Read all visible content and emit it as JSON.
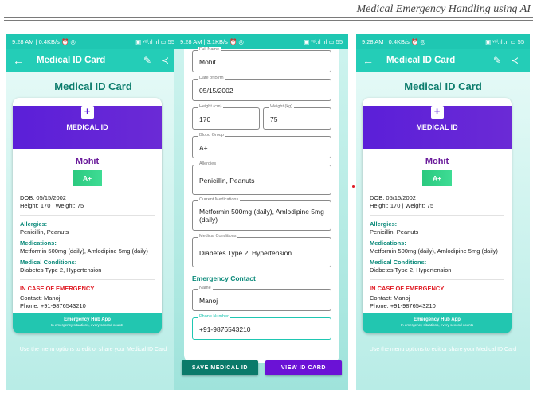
{
  "doc": {
    "title": "Medical Emergency Handling using AI"
  },
  "status": {
    "left1": "9:28 AM | 0.4KB/s ⏰ ◎",
    "left2": "9:28 AM | 3.1KB/s ⏰ ◎",
    "right": "▣ ᵛᵒˡ.ıl .ıl ▭ 55"
  },
  "appbar": {
    "title": "Medical ID Card",
    "back_icon": "arrow-left-icon",
    "edit_icon": "pencil-icon",
    "share_icon": "share-icon"
  },
  "card": {
    "heading": "Medical ID Card",
    "badge_label": "MEDICAL ID",
    "name": "Mohit",
    "blood": "A+",
    "dob": "DOB: 05/15/2002",
    "hw": "Height: 170 | Weight: 75",
    "allergies_label": "Allergies:",
    "allergies": "Penicillin, Peanuts",
    "meds_label": "Medications:",
    "meds": "Metformin 500mg (daily), Amlodipine 5mg (daily)",
    "conditions_label": "Medical Conditions:",
    "conditions": "Diabetes Type 2, Hypertension",
    "emergency_label": "IN CASE OF EMERGENCY",
    "contact": "Contact: Manoj",
    "phone": "Phone: +91-9876543210",
    "footer_title": "Emergency Hub App",
    "footer_sub": "In emergency situations, every second counts",
    "hint": "Use the menu options to edit or share your Medical ID Card"
  },
  "form": {
    "full_name_label": "Full Name",
    "full_name": "Mohit",
    "dob_label": "Date of Birth",
    "dob": "05/15/2002",
    "height_label": "Height (cm)",
    "height": "170",
    "weight_label": "Weight (kg)",
    "weight": "75",
    "blood_label": "Blood Group",
    "blood": "A+",
    "allergies_label": "Allergies",
    "allergies": "Penicillin, Peanuts",
    "meds_label": "Current Medications",
    "meds": "Metformin 500mg (daily), Amlodipine 5mg (daily)",
    "conditions_label": "Medical Conditions",
    "conditions": "Diabetes Type 2, Hypertension",
    "emergency_section": "Emergency Contact",
    "contact_name_label": "Name",
    "contact_name": "Manoj",
    "contact_phone_label": "Phone Number",
    "contact_phone": "+91-9876543210",
    "save_button": "SAVE MEDICAL ID",
    "view_button": "VIEW ID CARD"
  },
  "colors": {
    "teal": "#24cdb7",
    "purple": "#5b1fd8",
    "green": "#2bc97f",
    "red": "#e01b24"
  }
}
